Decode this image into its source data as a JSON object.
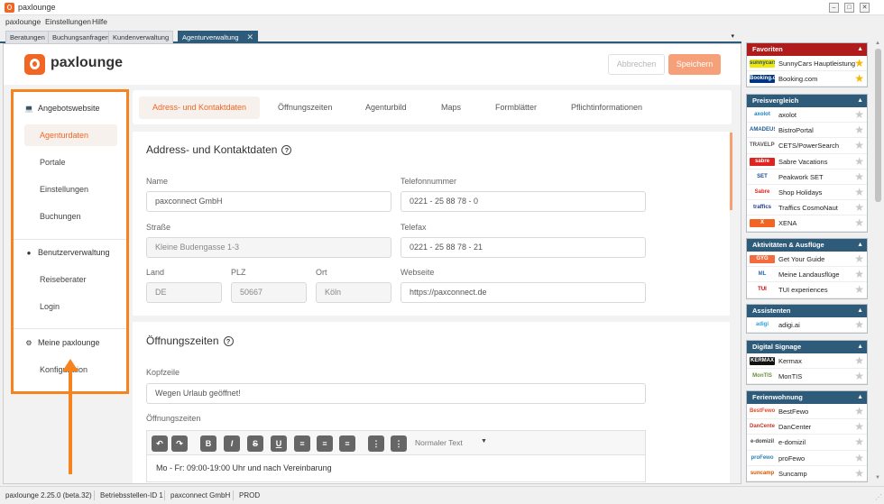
{
  "window": {
    "title": "paxlounge",
    "minimize": "–",
    "maximize": "□",
    "close": "✕"
  },
  "menu": [
    "paxlounge",
    "Einstellungen",
    "Hilfe"
  ],
  "doc_tabs": [
    "Beratungen",
    "Buchungsanfragen",
    "Kundenverwaltung",
    "Agenturverwaltung"
  ],
  "doc_tab_close": "✕",
  "doc_tab_dropdown": "▾",
  "header": {
    "logo_text": "paxlounge",
    "cancel_label": "Abbrechen",
    "save_label": "Speichern"
  },
  "sidebar": {
    "section1": {
      "title": "Angebotswebsite",
      "icon": "laptop-icon",
      "items": [
        "Agenturdaten",
        "Portale",
        "Einstellungen",
        "Buchungen"
      ]
    },
    "section2": {
      "title": "Benutzerverwaltung",
      "icon": "user-icon",
      "items": [
        "Reiseberater",
        "Login"
      ]
    },
    "section3": {
      "title": "Meine paxlounge",
      "icon": "gear-icon",
      "items": [
        "Konfiguration"
      ]
    }
  },
  "content_tabs": [
    "Adress- und Kontaktdaten",
    "Öffnungszeiten",
    "Agenturbild",
    "Maps",
    "Formblätter",
    "Pflichtinformationen"
  ],
  "address": {
    "title": "Address- und Kontaktdaten",
    "name_label": "Name",
    "name_value": "paxconnect GmbH",
    "phone_label": "Telefonnummer",
    "phone_value": "0221 - 25 88 78 - 0",
    "street_label": "Straße",
    "street_value": "Kleine Budengasse 1-3",
    "fax_label": "Telefax",
    "fax_value": "0221 - 25 88 78 - 21",
    "country_label": "Land",
    "country_value": "DE",
    "zip_label": "PLZ",
    "zip_value": "50667",
    "city_label": "Ort",
    "city_value": "Köln",
    "web_label": "Webseite",
    "web_value": "https://paxconnect.de"
  },
  "hours": {
    "title": "Öffnungszeiten",
    "header_label": "Kopfzeile",
    "header_value": "Wegen Urlaub geöffnet!",
    "hours_label": "Öffnungszeiten",
    "format_select": "Normaler Text",
    "editor_text": "Mo - Fr: 09:00-19:00 Uhr und nach Vereinbarung"
  },
  "toolbar_icons": [
    "undo-icon",
    "redo-icon",
    "bold-icon",
    "italic-icon",
    "strikethrough-icon",
    "underline-icon",
    "align-center-icon",
    "align-right-icon",
    "align-justify-icon",
    "ordered-list-icon",
    "bullet-list-icon"
  ],
  "right_panel": [
    {
      "title": "Favoriten",
      "color": "#b01c1c",
      "items": [
        {
          "label": "SunnyCars Hauptleistung",
          "logo": "sunnycars",
          "fav": true
        },
        {
          "label": "Booking.com",
          "logo": "Booking.com",
          "fav": true
        }
      ]
    },
    {
      "title": "Preisvergleich",
      "color": "#2f5b7a",
      "items": [
        {
          "label": "axolot",
          "logo": "axolot"
        },
        {
          "label": "BistroPortal",
          "logo": "AMADEUS"
        },
        {
          "label": "CETS/PowerSearch",
          "logo": "TRAVELPORT"
        },
        {
          "label": "Sabre Vacations",
          "logo": "sabre"
        },
        {
          "label": "Peakwork SET",
          "logo": "SET"
        },
        {
          "label": "Shop Holidays",
          "logo": "Sabre"
        },
        {
          "label": "Traffics CosmoNaut",
          "logo": "traffics"
        },
        {
          "label": "XENA",
          "logo": "X"
        }
      ]
    },
    {
      "title": "Aktivitäten & Ausflüge",
      "color": "#2f5b7a",
      "items": [
        {
          "label": "Get Your Guide",
          "logo": "GYG"
        },
        {
          "label": "Meine Landausflüge",
          "logo": "ML"
        },
        {
          "label": "TUI experiences",
          "logo": "TUI"
        }
      ]
    },
    {
      "title": "Assistenten",
      "color": "#2f5b7a",
      "items": [
        {
          "label": "adigi.ai",
          "logo": "adigi"
        }
      ]
    },
    {
      "title": "Digital Signage",
      "color": "#2f5b7a",
      "items": [
        {
          "label": "Kermax",
          "logo": "KERMAX"
        },
        {
          "label": "MonTIS",
          "logo": "MonTIS"
        }
      ]
    },
    {
      "title": "Ferienwohnung",
      "color": "#2f5b7a",
      "items": [
        {
          "label": "BestFewo",
          "logo": "BestFewo"
        },
        {
          "label": "DanCenter",
          "logo": "DanCenter"
        },
        {
          "label": "e-domizil",
          "logo": "e-domizil"
        },
        {
          "label": "proFewo",
          "logo": "proFewo"
        },
        {
          "label": "Suncamp",
          "logo": "suncamp"
        }
      ]
    }
  ],
  "status": [
    "paxlounge 2.25.0 (beta.32)",
    "Betriebsstellen-ID 1",
    "paxconnect GmbH",
    "PROD"
  ],
  "accent": "#f26522",
  "highlight": "#f7831f",
  "nav_color": "#2f5b7a"
}
